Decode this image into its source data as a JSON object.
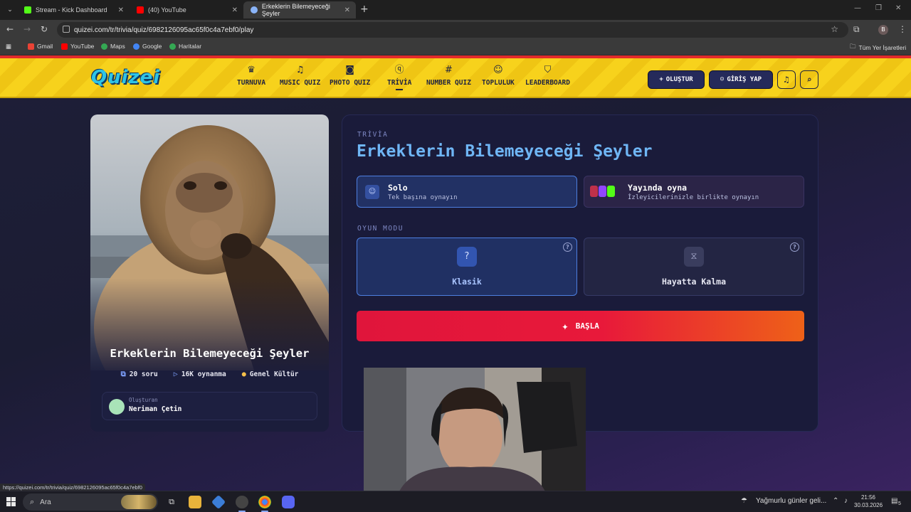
{
  "browser": {
    "tabs": [
      {
        "title": "Stream - Kick Dashboard",
        "favicon_color": "#53fc18",
        "favicon_letter": "K"
      },
      {
        "title": "(40) YouTube",
        "favicon_color": "#ff0000",
        "favicon_letter": "▶"
      },
      {
        "title": "Erkeklerin Bilemeyeceği Şeyler",
        "favicon_color": "#8ab4f8",
        "favicon_letter": "⚙"
      }
    ],
    "url": "quizei.com/tr/trivia/quiz/6982126095ac65f0c4a7ebf0/play",
    "bookmarks": [
      {
        "label": "Gmail",
        "color": "#ea4335"
      },
      {
        "label": "YouTube",
        "color": "#ff0000"
      },
      {
        "label": "Maps",
        "color": "#34a853"
      },
      {
        "label": "Google",
        "color": "#4285f4"
      },
      {
        "label": "Haritalar",
        "color": "#34a853"
      }
    ],
    "all_bookmarks": "Tüm Yer İşaretleri",
    "profile_letter": "B",
    "status_url": "https://quizei.com/tr/trivia/quiz/6982126095ac65f0c4a7ebf0"
  },
  "site": {
    "logo": "Quizei",
    "nav": [
      {
        "label": "TURNUVA",
        "icon": "trophy-icon",
        "glyph": "🏆"
      },
      {
        "label": "MUSIC QUIZ",
        "icon": "music-note-icon",
        "glyph": "♫"
      },
      {
        "label": "PHOTO QUIZ",
        "icon": "camera-icon",
        "glyph": "◙"
      },
      {
        "label": "TRİVİA",
        "icon": "question-bubble-icon",
        "glyph": "?"
      },
      {
        "label": "NUMBER QUIZ",
        "icon": "hash-icon",
        "glyph": "#"
      },
      {
        "label": "TOPLULUK",
        "icon": "users-icon",
        "glyph": "☺"
      },
      {
        "label": "LEADERBOARD",
        "icon": "medal-icon",
        "glyph": "⛉"
      }
    ],
    "create_label": "OLUŞTUR",
    "login_label": "GİRİŞ YAP"
  },
  "quiz": {
    "title": "Erkeklerin Bilemeyeceği Şeyler",
    "questions": "20 soru",
    "plays": "16K oynanma",
    "category": "Genel Kültür",
    "creator_label": "Oluşturan",
    "creator_name": "Neriman Çetin"
  },
  "play": {
    "kicker": "TRİVİA",
    "title": "Erkeklerin Bilemeyeceği Şeyler",
    "solo_title": "Solo",
    "solo_sub": "Tek başına oynayın",
    "live_title": "Yayında oyna",
    "live_sub": "İzleyicilerinizle birlikte oynayın",
    "mode_label": "OYUN MODU",
    "mode_classic": "Klasik",
    "mode_survival": "Hayatta Kalma",
    "start_label": "BAŞLA",
    "accent_colors": {
      "start_from": "#e0153b",
      "start_to": "#ee6118",
      "selected": "#4d7fe0",
      "title": "#6fb6f5"
    }
  },
  "taskbar": {
    "search_placeholder": "Ara",
    "weather": "Yağmurlu günler geli...",
    "time": "21:56",
    "date": "30.03.2026",
    "notification_count": "5"
  }
}
